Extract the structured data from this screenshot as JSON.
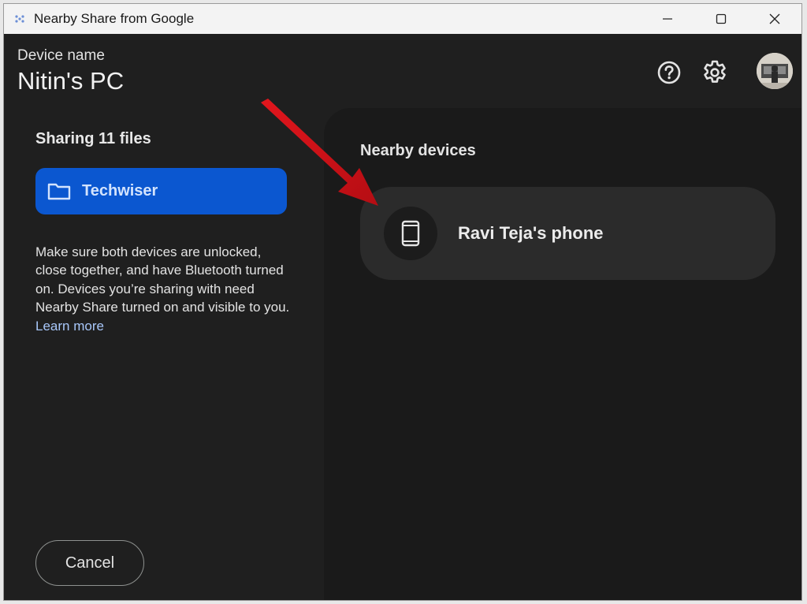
{
  "window": {
    "title": "Nearby Share from Google",
    "controls": {
      "minimize": "minimize-icon",
      "maximize": "maximize-icon",
      "close": "close-icon"
    }
  },
  "header": {
    "device_label": "Device name",
    "device_name": "Nitin's PC",
    "icons": [
      "help-icon",
      "gear-icon",
      "avatar"
    ]
  },
  "sidebar": {
    "sharing_title": "Sharing 11 files",
    "file_chip": {
      "name": "Techwiser",
      "icon": "folder-icon"
    },
    "info_text": "Make sure both devices are unlocked, close together, and have Bluetooth turned on. Devices you’re sharing with need Nearby Share turned on and visible to you.",
    "learn_more": "Learn more",
    "cancel_label": "Cancel"
  },
  "main": {
    "nearby_title": "Nearby devices",
    "devices": [
      {
        "name": "Ravi Teja's phone",
        "icon": "phone-icon"
      }
    ]
  },
  "colors": {
    "accent": "#0b57d0",
    "background": "#1f1f1f",
    "panel": "#1a1a1a",
    "card": "#2b2b2b",
    "link": "#a8c7fa",
    "annotation_arrow": "#d0141a"
  }
}
